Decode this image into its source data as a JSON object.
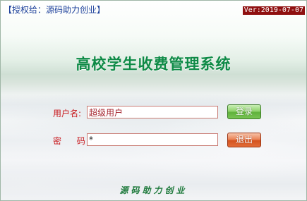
{
  "header": {
    "license": "【授权给：源码助力创业】",
    "version": "Ver:2019-07-07"
  },
  "title": "高校学生收费管理系统",
  "form": {
    "username_label": "用户名:",
    "username_value": "超级用户",
    "password_label": "密 码:",
    "password_value": "*"
  },
  "buttons": {
    "login": "登录",
    "exit": "退出"
  },
  "footer": "源码助力创业",
  "colors": {
    "title": "#0e8a46",
    "label": "#c8171b",
    "license_text": "#1b3f9a",
    "version_bg": "#8f1010",
    "login_button": "#79c455",
    "exit_button": "#e26c38"
  }
}
